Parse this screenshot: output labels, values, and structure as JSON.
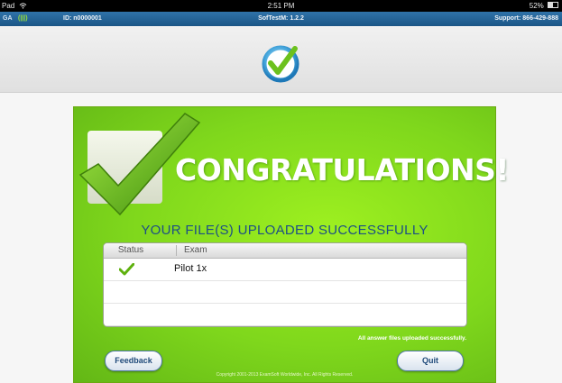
{
  "status_bar": {
    "device": "Pad",
    "time": "2:51 PM",
    "battery": "52%"
  },
  "app_bar": {
    "ga_label": "GA",
    "signal_label": "(|||)",
    "device_id": "ID: n0000001",
    "app_version": "SofTestM: 1.2.2",
    "support": "Support: 866-429-888"
  },
  "card": {
    "title": "CONGRATULATIONS!",
    "subtitle": "YOUR FILE(S) UPLOADED SUCCESSFULLY",
    "table": {
      "columns": [
        "Status",
        "Exam"
      ],
      "rows": [
        {
          "status_icon": "green-checkmark",
          "exam": "Pilot 1x"
        },
        {
          "status_icon": "",
          "exam": ""
        },
        {
          "status_icon": "",
          "exam": ""
        }
      ]
    },
    "all_uploaded_text": "All answer files uploaded successfully.",
    "feedback_label": "Feedback",
    "quit_label": "Quit",
    "copyright": "Copyright 2001-2013 ExamSoft Worldwide, Inc. All Rights Reserved."
  },
  "icons": {
    "logo": "softest-checkmark-logo",
    "big_check": "large-green-checkmark"
  },
  "colors": {
    "app_bar": "#2f73a9",
    "card_green": "#7fd71c",
    "subtitle_blue": "#1d4f86",
    "check_green": "#5fb10e"
  }
}
